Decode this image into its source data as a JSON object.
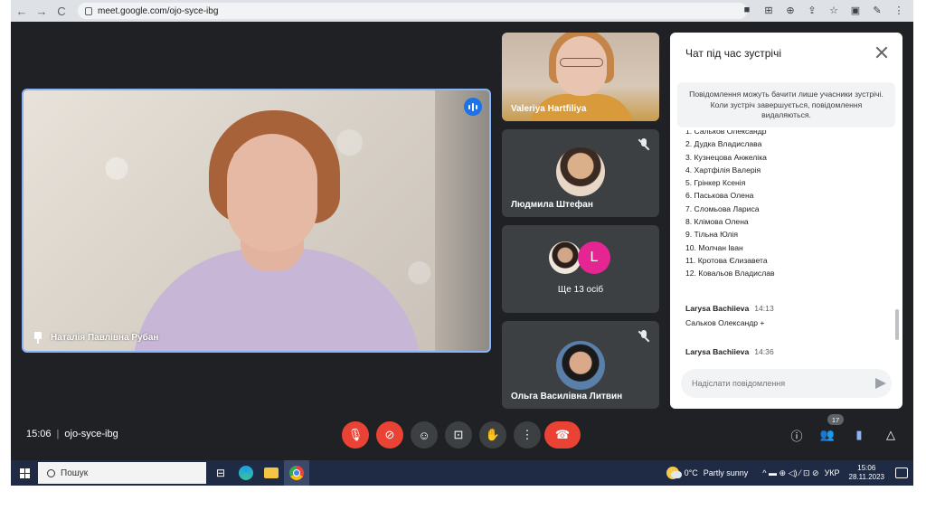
{
  "browser": {
    "url": "meet.google.com/ojo-syce-ibg",
    "back_label": "←",
    "forward_label": "→",
    "reload_label": "C",
    "tools": [
      "■",
      "⊞",
      "⊕",
      "⇪",
      "☆",
      "▣",
      "✎",
      "⋮"
    ]
  },
  "main_speaker": {
    "name": "Наталія Павлівна Рубан"
  },
  "tiles": [
    {
      "name": "Valeriya Hartfiliya"
    },
    {
      "name": "Людмила Штефан",
      "muted": true
    },
    {
      "others_label": "Ще 13 осіб",
      "avatar_letter": "L"
    },
    {
      "name": "Ольга Василівна Литвин",
      "muted": true
    }
  ],
  "chat": {
    "title": "Чат під час зустрічі",
    "notice": "Повідомлення можуть бачити лише учасники зустрічі. Коли зустріч завершується, повідомлення видаляються.",
    "list_items": [
      "1. Сальков Олександр",
      "2. Дудка Владислава",
      "3. Кузнецова Анжеліка",
      "4. Хартфілія Валерія",
      "5. Грінкер Ксенія",
      "6. Паськова Олена",
      "7. Сломьова Лариса",
      "8. Клімова Олена",
      "9. Тільна Юлія",
      "10. Молчан Іван",
      "11. Кротова Єлизавета",
      "12. Ковальов Владислав"
    ],
    "messages": [
      {
        "sender": "Larysa Bachiieva",
        "time": "14:13",
        "text": "Сальков Олександр +"
      },
      {
        "sender": "Larysa Bachiieva",
        "time": "14:36",
        "text": ""
      }
    ],
    "input_placeholder": "Надіслати повідомлення"
  },
  "meeting": {
    "time": "15:06",
    "code": "ojo-syce-ibg",
    "people_count": "17"
  },
  "controls": {
    "mic": "🎙",
    "cam": "⊘",
    "emoji": "☺",
    "present": "⊡",
    "hand": "✋",
    "more": "⋮",
    "leave": "☎",
    "info": "ⓘ",
    "people": "👥",
    "chat": "▮",
    "activities": "△"
  },
  "taskbar": {
    "search_label": "Пошук",
    "weather": "0°C",
    "weather_desc": "Partly sunny",
    "lang": "УКР",
    "clock_time": "15:06",
    "clock_date": "28.11.2023",
    "tray_icons": "^ ▬ ⊕ ◁) ⁄ ⊡ ⊘"
  },
  "colors": {
    "accent": "#1a73e8",
    "danger": "#ea4335",
    "surface": "#202124",
    "tile": "#3c4043"
  }
}
